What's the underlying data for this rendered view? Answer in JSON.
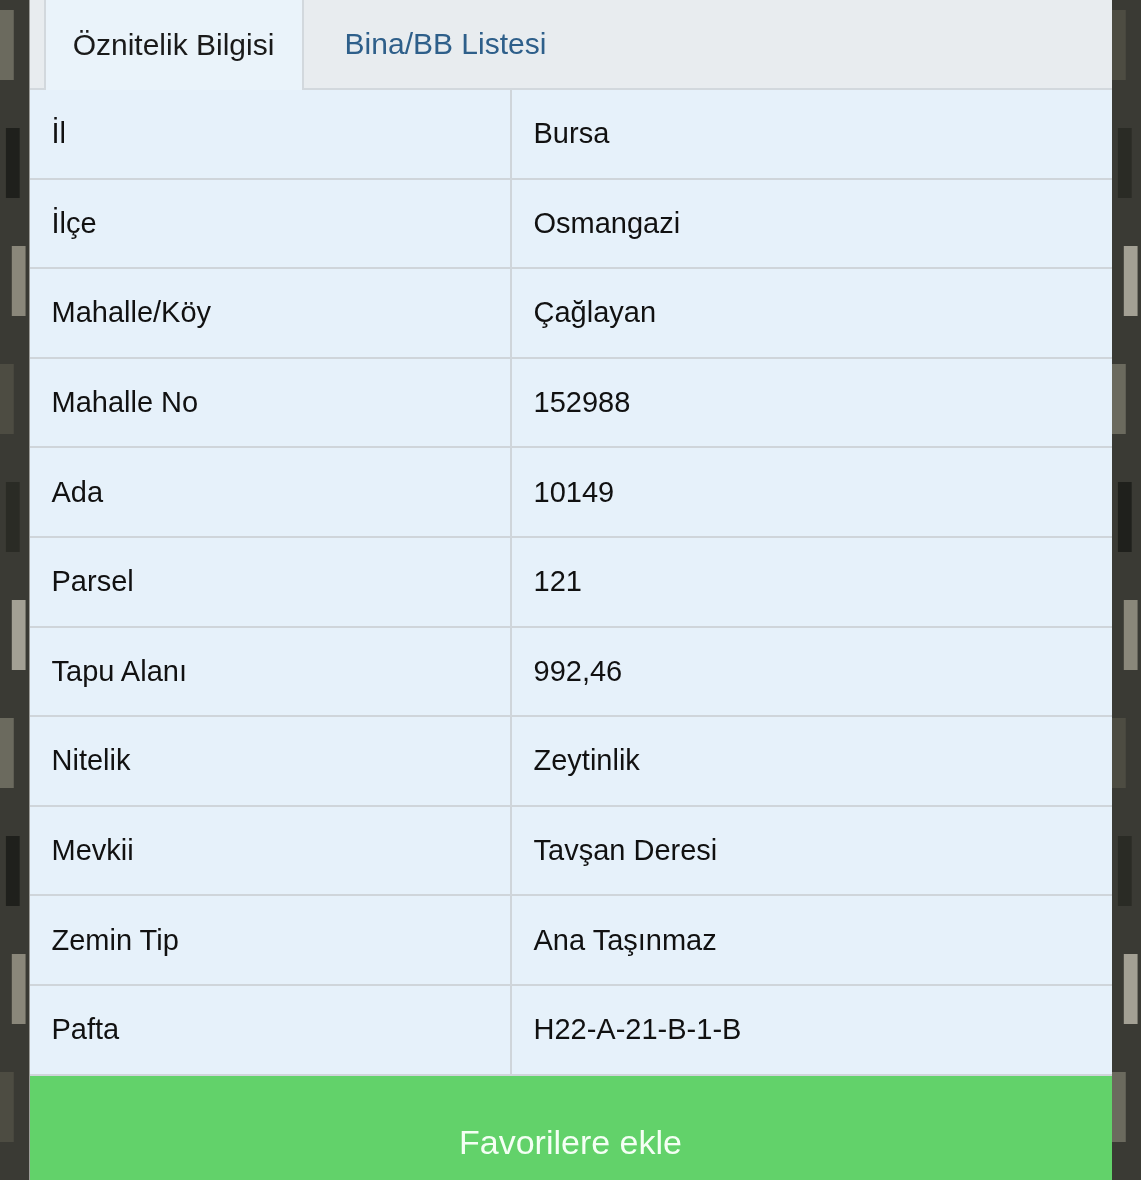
{
  "tabs": [
    {
      "label": "Öznitelik Bilgisi",
      "selected": true
    },
    {
      "label": "Bina/BB Listesi",
      "selected": false
    }
  ],
  "table": {
    "rows": [
      {
        "label": "İl",
        "value": "Bursa"
      },
      {
        "label": "İlçe",
        "value": "Osmangazi"
      },
      {
        "label": "Mahalle/Köy",
        "value": "Çağlayan"
      },
      {
        "label": "Mahalle No",
        "value": "152988"
      },
      {
        "label": "Ada",
        "value": "10149"
      },
      {
        "label": "Parsel",
        "value": "121"
      },
      {
        "label": "Tapu Alanı",
        "value": "992,46"
      },
      {
        "label": "Nitelik",
        "value": "Zeytinlik"
      },
      {
        "label": "Mevkii",
        "value": "Tavşan Deresi"
      },
      {
        "label": "Zemin Tip",
        "value": "Ana Taşınmaz"
      },
      {
        "label": "Pafta",
        "value": "H22-A-21-B-1-B"
      }
    ]
  },
  "button": {
    "label": "Favorilere ekle"
  }
}
